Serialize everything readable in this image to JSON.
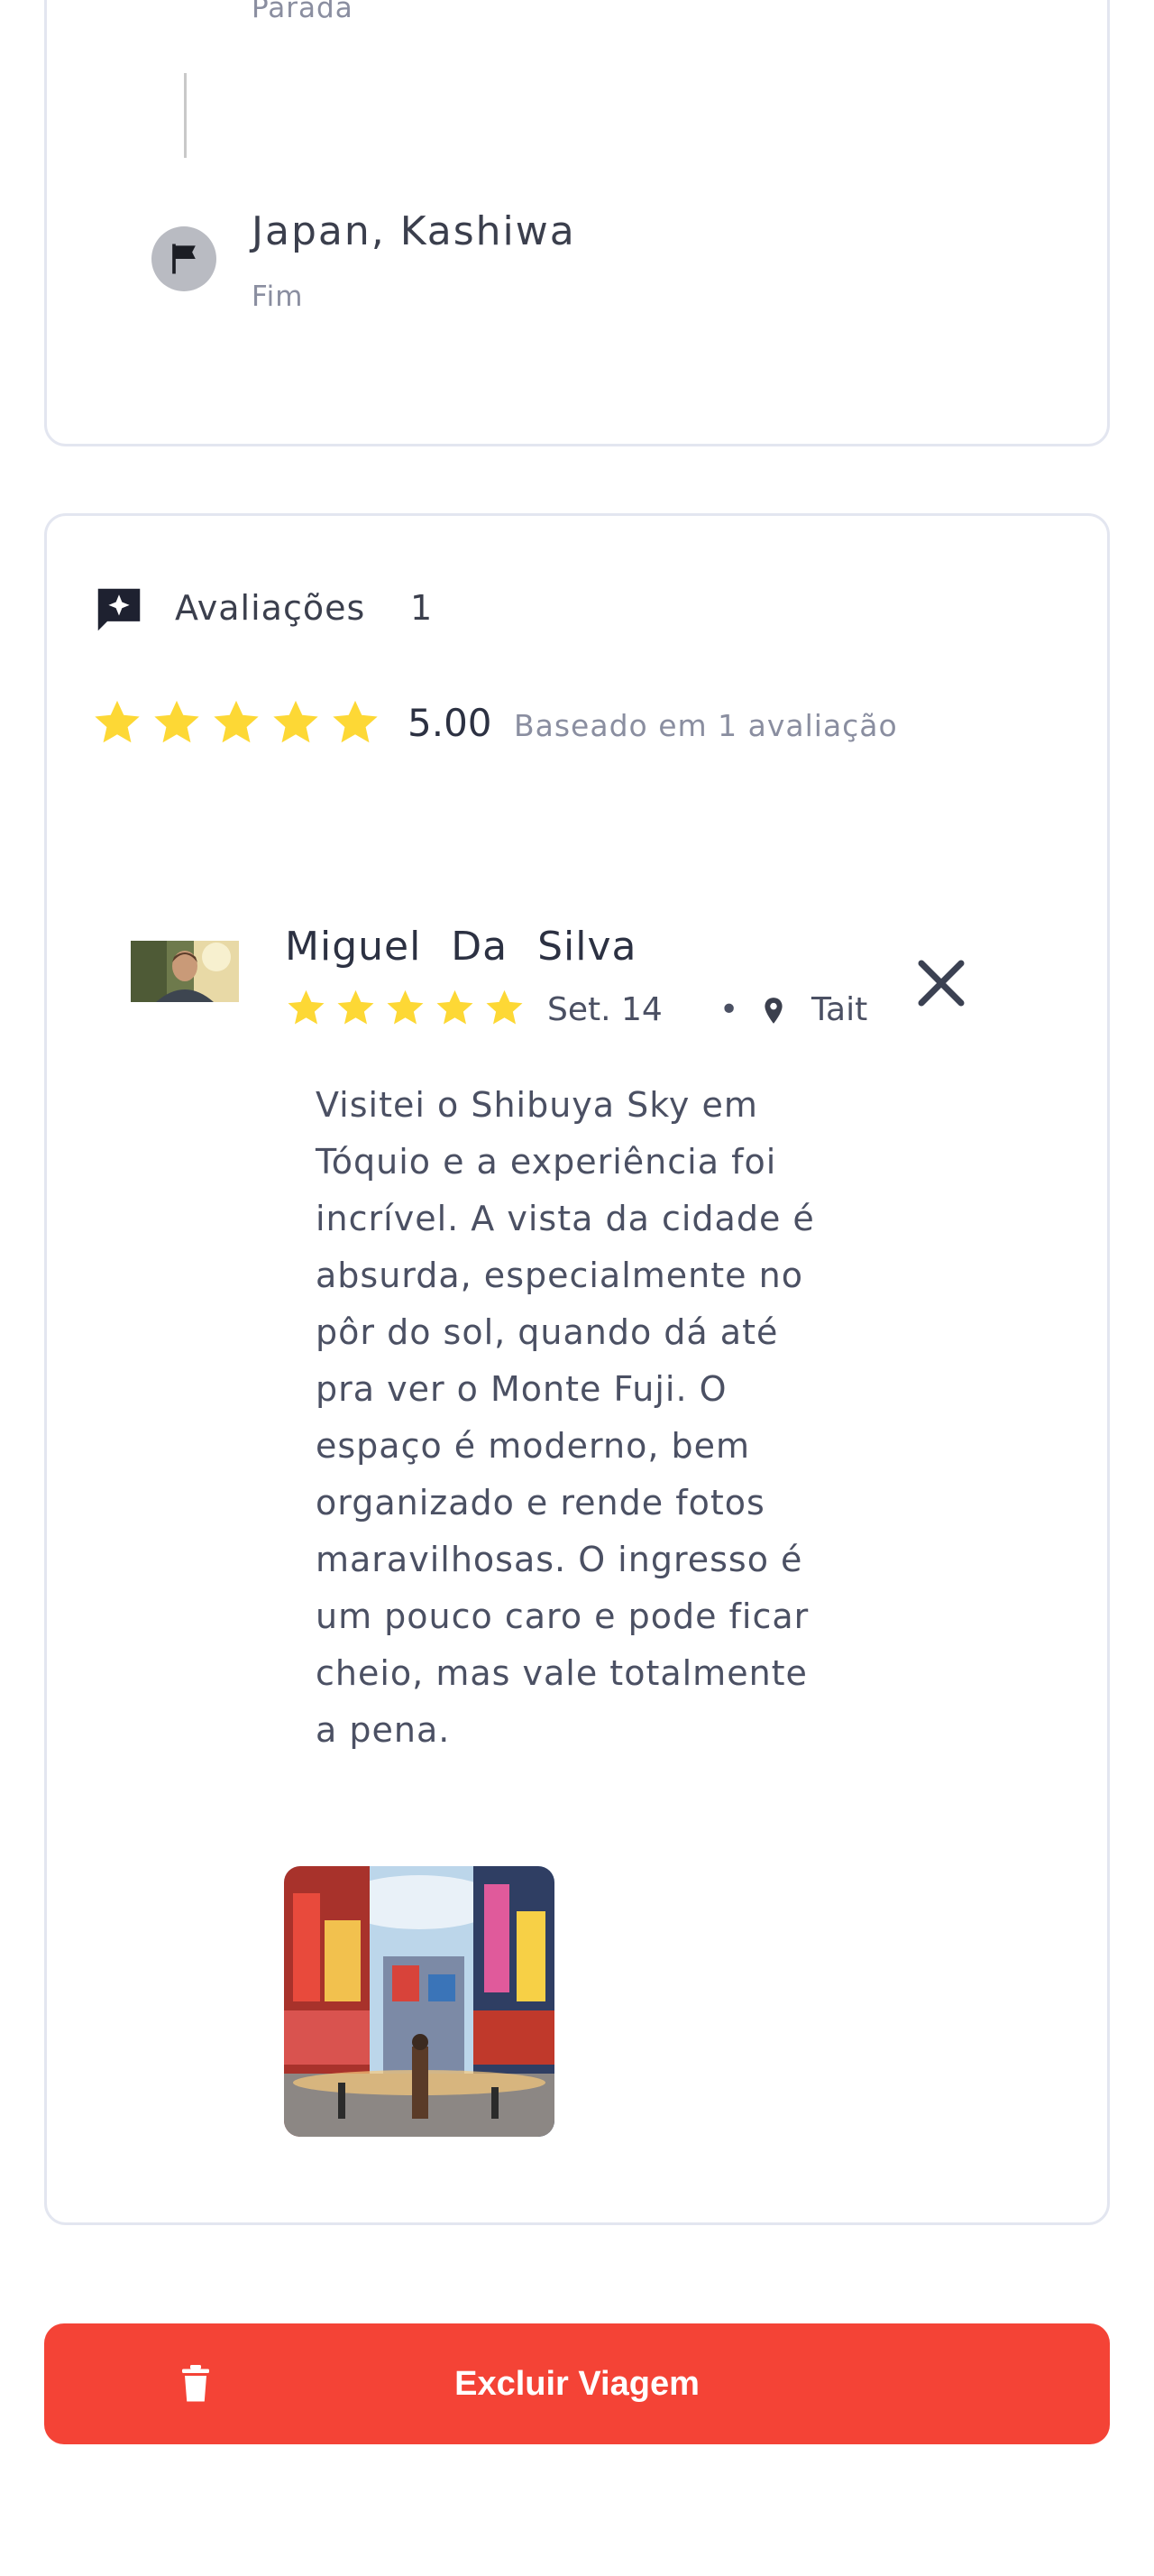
{
  "route": {
    "prev_stop_type": "Parada",
    "end_stop": {
      "name": "Japan, Kashiwa",
      "type": "Fim"
    }
  },
  "reviews": {
    "title": "Avaliações",
    "count": "1",
    "average": "5.00",
    "average_stars": 5,
    "caption": "Baseado em 1 avaliação",
    "items": [
      {
        "author": "Miguel Da Silva",
        "stars": 5,
        "date": "Set. 14",
        "separator": "•",
        "location": "Tait",
        "text": "Visitei o Shibuya Sky em Tóquio e a experiência foi incrível. A vista da cidade é absurda, especialmente no pôr do sol, quando dá até pra ver o Monte Fuji. O espaço é moderno, bem organizado e rende fotos maravilhosas. O ingresso é um pouco caro e pode ficar cheio, mas vale totalmente a pena."
      }
    ]
  },
  "actions": {
    "delete_label": "Excluir Viagem"
  },
  "colors": {
    "star": "#fdd835",
    "danger": "#f44336",
    "border": "#e3e6f0"
  },
  "icons": [
    "flag-icon",
    "review-sparkle-icon",
    "star-icon",
    "location-pin-icon",
    "close-icon",
    "trash-icon"
  ]
}
